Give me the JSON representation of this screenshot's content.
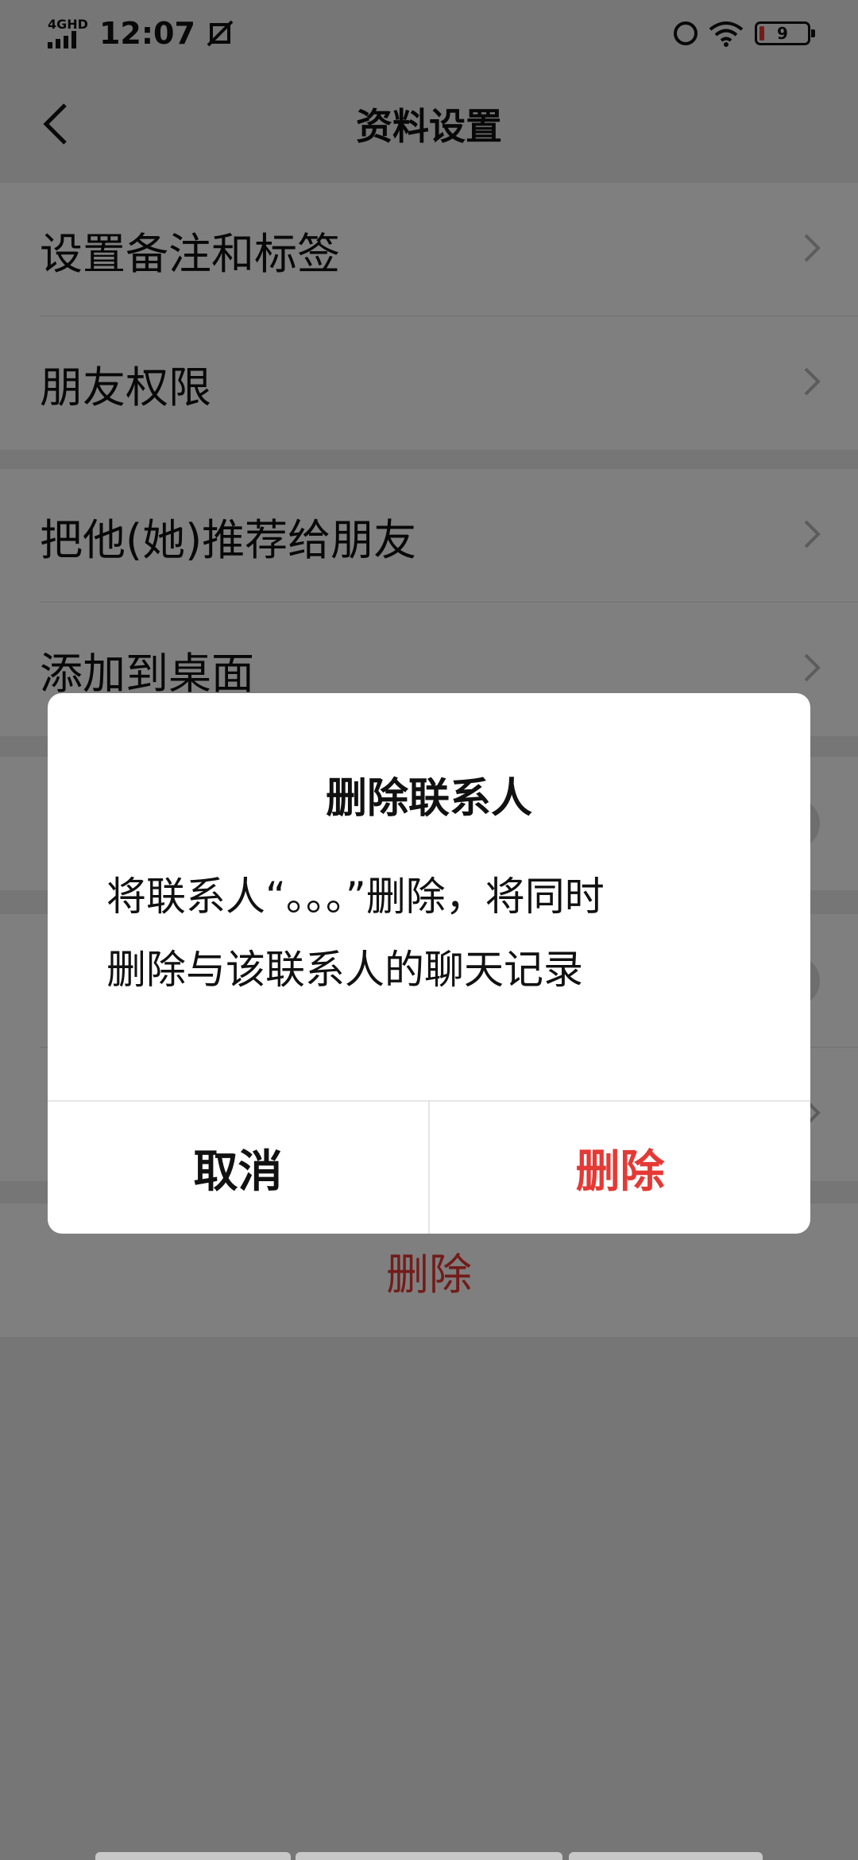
{
  "status_bar": {
    "network": "4GHD",
    "time": "12:07",
    "battery": "9"
  },
  "nav": {
    "title": "资料设置"
  },
  "sections": {
    "remark": "设置备注和标签",
    "permissions": "朋友权限",
    "recommend": "把他(她)推荐给朋友",
    "desktop": "添加到桌面",
    "delete": "删除"
  },
  "dialog": {
    "title": "删除联系人",
    "line1": "将联系人“。。。”删除，将同时",
    "line2": "删除与该联系人的聊天记录",
    "cancel": "取消",
    "confirm": "删除"
  }
}
